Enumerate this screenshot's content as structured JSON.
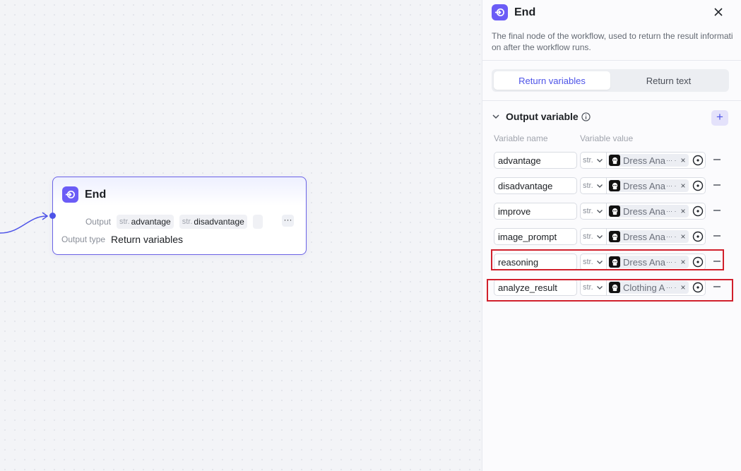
{
  "node": {
    "title": "End",
    "output_label": "Output",
    "outputs": [
      {
        "type": "str.",
        "name": "advantage"
      },
      {
        "type": "str.",
        "name": "disadvantage"
      }
    ],
    "more_label": "···",
    "output_type_label": "Output type",
    "output_type_value": "Return variables"
  },
  "panel": {
    "title": "End",
    "description": "The final node of the workflow, used to return the result information after the workflow runs.",
    "tabs": [
      {
        "label": "Return variables",
        "active": true
      },
      {
        "label": "Return text",
        "active": false
      }
    ],
    "section_title": "Output variable",
    "add_label": "+",
    "col_name": "Variable name",
    "col_value": "Variable value",
    "variables": [
      {
        "name": "advantage",
        "type": "str.",
        "ref": "Dress Anal",
        "highlighted": false
      },
      {
        "name": "disadvantage",
        "type": "str.",
        "ref": "Dress Anal",
        "highlighted": false
      },
      {
        "name": "improve",
        "type": "str.",
        "ref": "Dress Anal",
        "highlighted": false
      },
      {
        "name": "image_prompt",
        "type": "str.",
        "ref": "Dress Anal",
        "highlighted": false
      },
      {
        "name": "reasoning",
        "type": "str.",
        "ref": "Dress Anal",
        "highlighted": true
      },
      {
        "name": "analyze_result",
        "type": "str.",
        "ref": "Clothing A",
        "highlighted": true
      }
    ],
    "ref_ellipsis": "··· ·",
    "ref_remove": "×"
  },
  "colors": {
    "accent": "#4d53e8",
    "node_icon": "#6b5cf6",
    "highlight": "#d1202c"
  }
}
